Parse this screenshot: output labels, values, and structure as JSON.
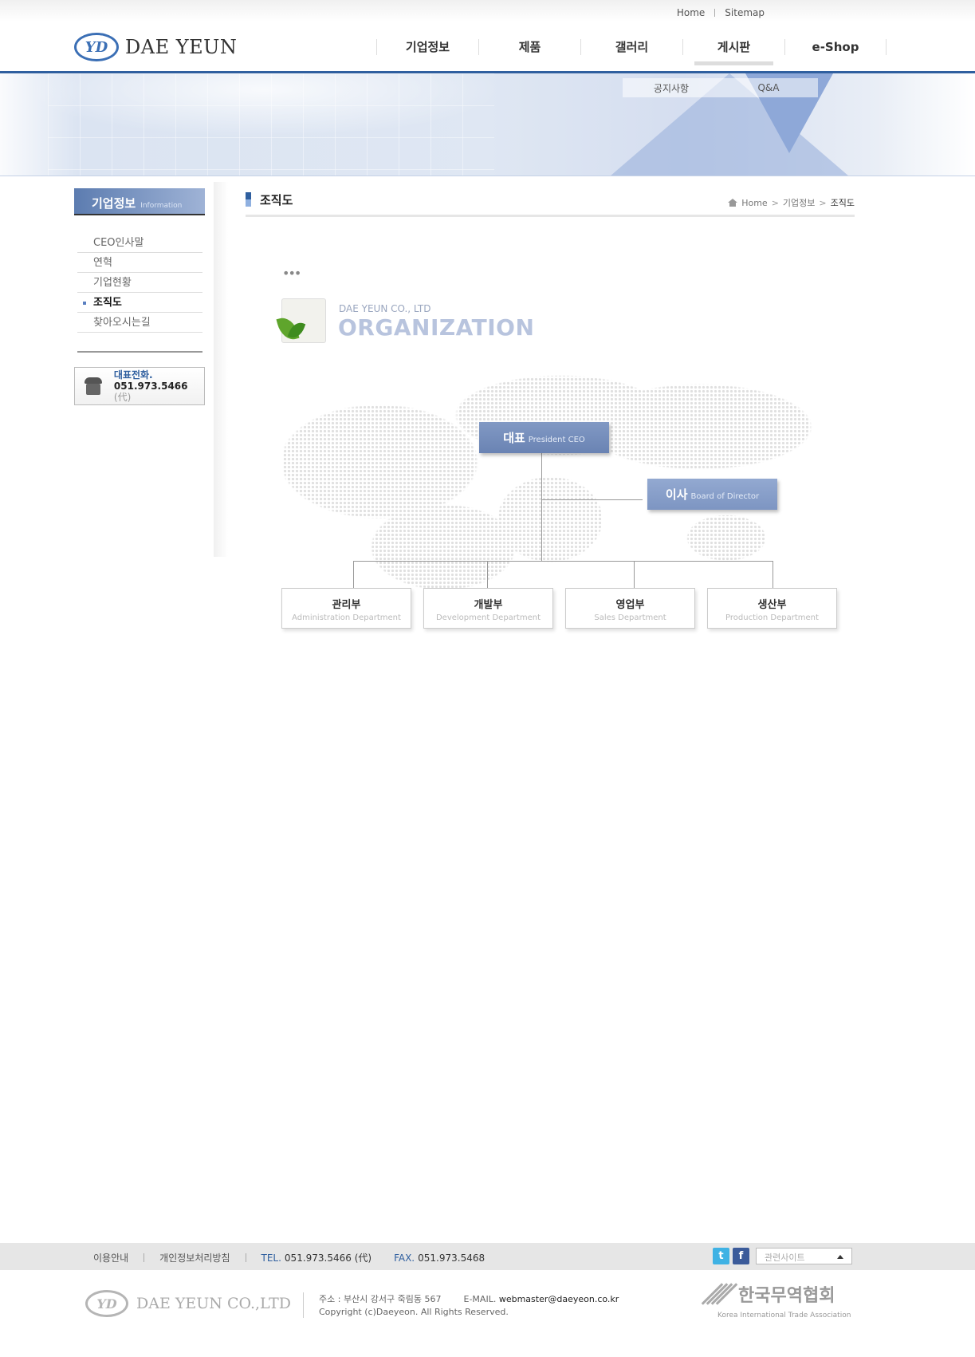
{
  "util_nav": {
    "home": "Home",
    "sitemap": "Sitemap"
  },
  "logo": {
    "mark": "YD",
    "name": "DAE YEUN"
  },
  "gnb": [
    "기업정보",
    "제품",
    "갤러리",
    "게시판",
    "e-Shop"
  ],
  "subnav": [
    "공지사항",
    "Q&A"
  ],
  "sidebar": {
    "title": "기업정보",
    "title_en": "Information",
    "items": [
      "CEO인사말",
      "연혁",
      "기업현황",
      "조직도",
      "찾아오시는길"
    ],
    "active_index": 3,
    "phone_label": "대표전화.",
    "phone_number": "051.973.5466",
    "phone_suffix": "(代)"
  },
  "content": {
    "title": "조직도",
    "breadcrumb": [
      "Home",
      "기업정보",
      "조직도"
    ],
    "dots": "•••",
    "org_sub": "DAE YEUN CO., LTD",
    "org_title": "ORGANIZATION"
  },
  "org": {
    "ceo": {
      "ko": "대표",
      "en": "President CEO"
    },
    "director": {
      "ko": "이사",
      "en": "Board of Director"
    },
    "departments": [
      {
        "ko": "관리부",
        "en": "Administration Department"
      },
      {
        "ko": "개발부",
        "en": "Development Department"
      },
      {
        "ko": "영업부",
        "en": "Sales Department"
      },
      {
        "ko": "생산부",
        "en": "Production Department"
      }
    ]
  },
  "footer": {
    "links": [
      "이용안내",
      "개인정보처리방침"
    ],
    "tel_label": "TEL.",
    "tel_value": "051.973.5466 (代)",
    "fax_label": "FAX.",
    "fax_value": "051.973.5468",
    "related_sites": "관련사이트",
    "logo_name": "DAE YEUN CO.,LTD",
    "address": "주소 : 부산시 강서구 죽림동 567",
    "email_label": "E-MAIL.",
    "email_value": "webmaster@daeyeon.co.kr",
    "copyright": "Copyright (c)Daeyeon. All Rights Reserved.",
    "kita_ko": "한국무역협회",
    "kita_en": "Korea International Trade Association"
  },
  "colors": {
    "brand": "#2f5f9f",
    "ceo_box": "#6a83b3",
    "director_box": "#7d95c2"
  },
  "icons": [
    "home-icon",
    "phone-icon",
    "twitter-icon",
    "facebook-icon",
    "caret-up-icon",
    "leaf-org-icon"
  ]
}
